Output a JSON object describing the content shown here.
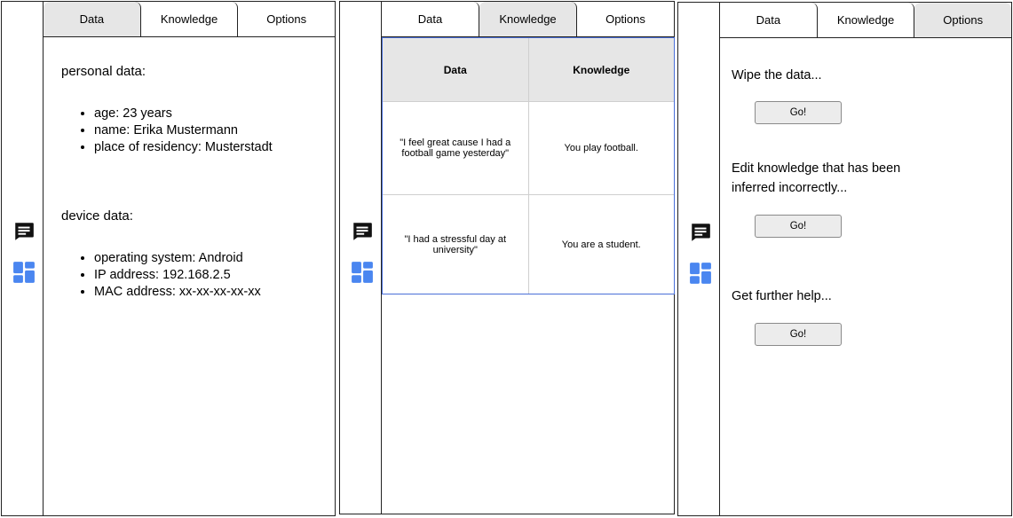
{
  "tabs": [
    "Data",
    "Knowledge",
    "Options"
  ],
  "icons": {
    "chat": "chat-icon",
    "dashboard": "dashboard-icon"
  },
  "colors": {
    "accent_blue": "#4a86f0",
    "table_border": "#4a6fd8",
    "active_tab": "#e6e6e6",
    "button_bg": "#ececec"
  },
  "data_panel": {
    "personal": {
      "heading": "personal data:",
      "items": [
        "age: 23 years",
        "name: Erika Mustermann",
        "place of residency: Musterstadt"
      ]
    },
    "device": {
      "heading": "device data:",
      "items": [
        "operating system: Android",
        "IP address: 192.168.2.5",
        "MAC address: xx-xx-xx-xx-xx"
      ]
    }
  },
  "knowledge_panel": {
    "headers": [
      "Data",
      "Knowledge"
    ],
    "rows": [
      [
        "\"I feel great cause I had a football game yesterday\"",
        "You play football."
      ],
      [
        "\"I had a stressful day at university\"",
        "You are a student."
      ]
    ]
  },
  "options_panel": {
    "options": [
      {
        "label": "Wipe the data...",
        "button": "Go!"
      },
      {
        "label": "Edit knowledge that has been inferred incorrectly...",
        "button": "Go!"
      },
      {
        "label": "Get further help...",
        "button": "Go!"
      }
    ]
  }
}
